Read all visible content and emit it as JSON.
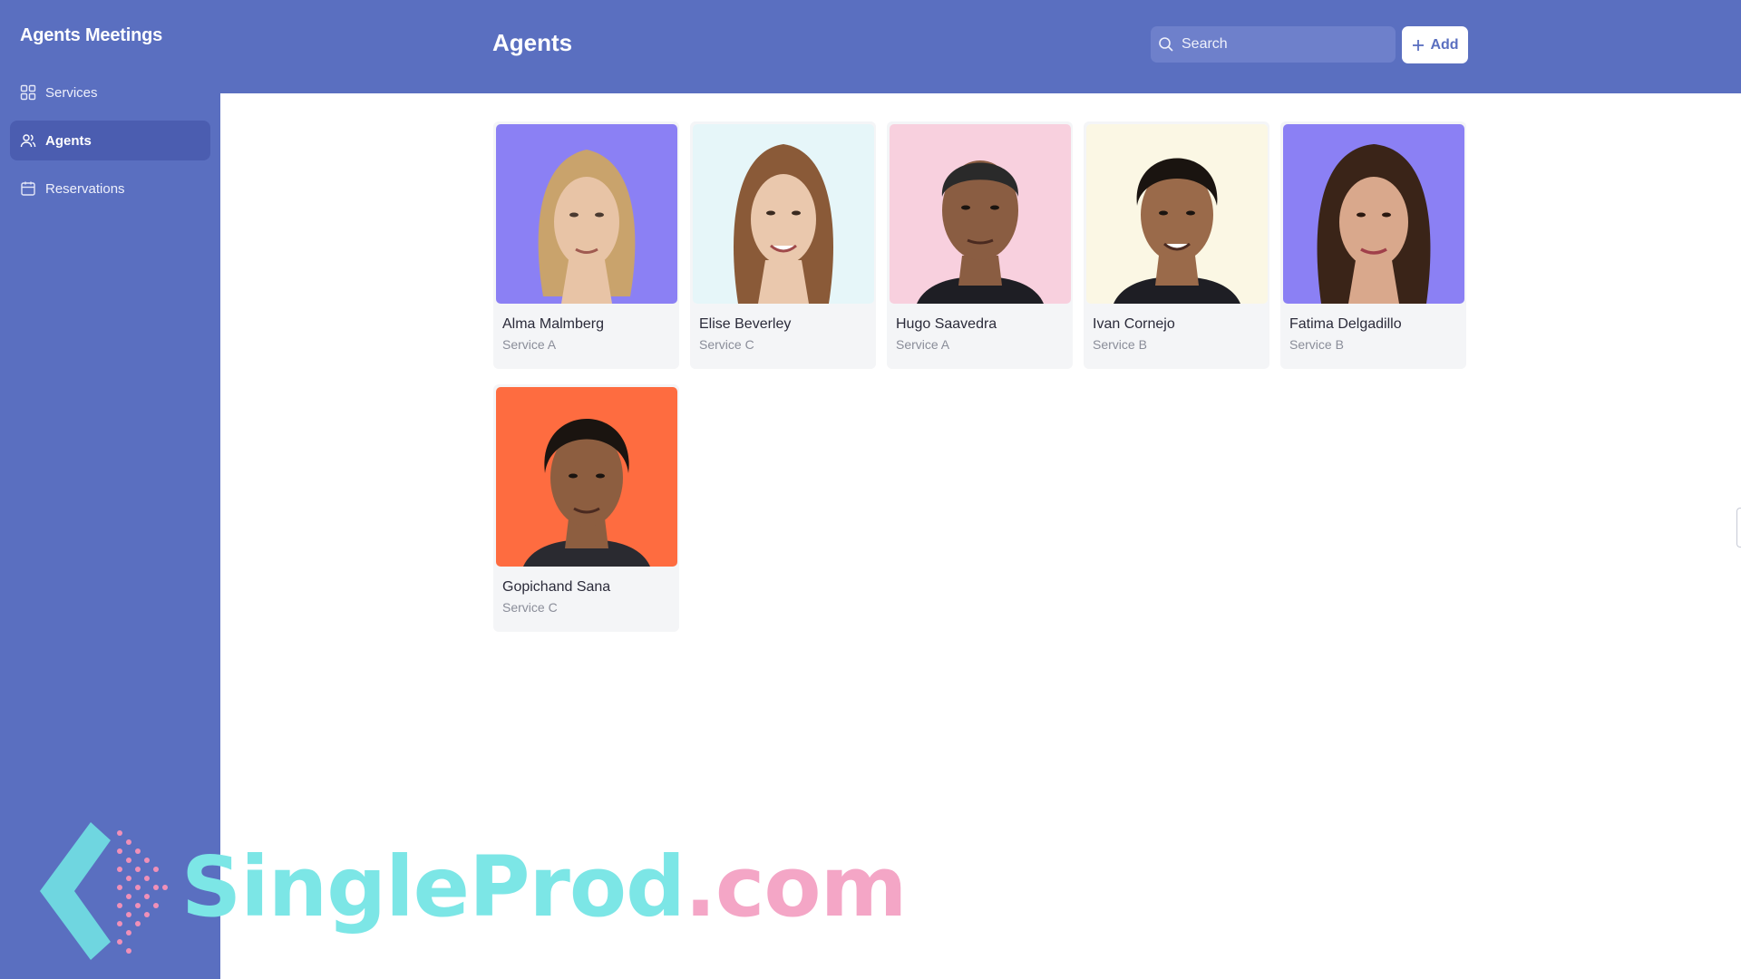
{
  "app": {
    "title": "Agents Meetings"
  },
  "sidebar": {
    "items": [
      {
        "label": "Services",
        "icon": "grid-icon",
        "active": false
      },
      {
        "label": "Agents",
        "icon": "users-icon",
        "active": true
      },
      {
        "label": "Reservations",
        "icon": "calendar-icon",
        "active": false
      }
    ]
  },
  "header": {
    "title": "Agents",
    "search_placeholder": "Search",
    "add_label": "Add"
  },
  "agents": [
    {
      "name": "Alma Malmberg",
      "service": "Service A",
      "bg": "#8b80f4",
      "skin": "#e8c4a6",
      "hair": "#c9a36c"
    },
    {
      "name": "Elise Beverley",
      "service": "Service C",
      "bg": "#e6f6f9",
      "skin": "#eac8ad",
      "hair": "#8a5a38"
    },
    {
      "name": "Hugo Saavedra",
      "service": "Service A",
      "bg": "#f8d0de",
      "skin": "#8a5d42",
      "hair": "#2a2a2a"
    },
    {
      "name": "Ivan Cornejo",
      "service": "Service B",
      "bg": "#fbf7e4",
      "skin": "#9a6a4a",
      "hair": "#1a1410"
    },
    {
      "name": "Fatima Delgadillo",
      "service": "Service B",
      "bg": "#8b80f4",
      "skin": "#d9a88c",
      "hair": "#3a2418"
    },
    {
      "name": "Gopichand Sana",
      "service": "Service C",
      "bg": "#fe6c40",
      "skin": "#8d5e40",
      "hair": "#1a1410"
    }
  ],
  "watermark": {
    "part1": "SingleProd",
    "part2": ".com"
  },
  "colors": {
    "primary": "#5a6fc0",
    "sidebar_active": "#4b5db0"
  }
}
